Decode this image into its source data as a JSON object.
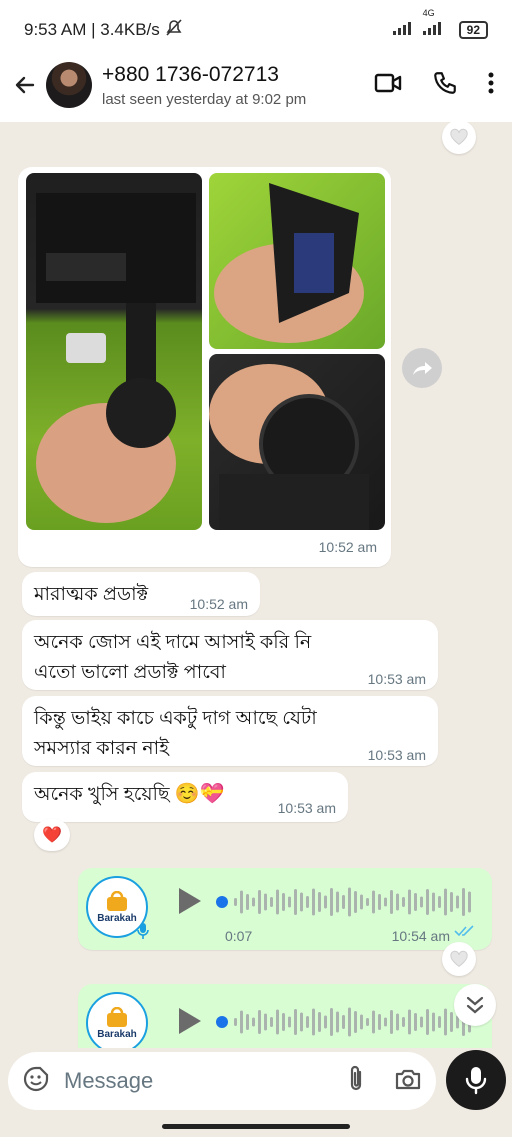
{
  "status_bar": {
    "time_info": "9:53 AM | 3.4KB/s",
    "network": "4G",
    "battery": "92"
  },
  "header": {
    "contact_name": "+880 1736-072713",
    "last_seen": "last seen yesterday at 9:02 pm"
  },
  "messages": {
    "album_time": "10:52 am",
    "m1_text": "মারাত্মক প্রডাক্ট",
    "m1_time": "10:52 am",
    "m2_text": "অনেক জোস এই দামে আসাই করি নি এতো ভালো প্রডাক্ট পাবো",
    "m2_time": "10:53 am",
    "m3_text": "কিন্তু ভাইয় কাচে একটু দাগ আছে যেটা সমস্যার কারন নাই",
    "m3_time": "10:53 am",
    "m4_text": "অনেক খুসি হয়েছি",
    "m4_emoji": "☺️💝",
    "m4_time": "10:53 am",
    "reaction": "❤️",
    "voice1_duration": "0:07",
    "voice1_time": "10:54 am",
    "voice_avatar_label": "Barakah"
  },
  "composer": {
    "placeholder": "Message"
  },
  "colors": {
    "incoming_bubble": "#ffffff",
    "outgoing_bubble": "#d9fdd3",
    "chat_bg": "#efeae2",
    "read_ticks": "#53bdeb",
    "voice_dot": "#1a73e8"
  }
}
